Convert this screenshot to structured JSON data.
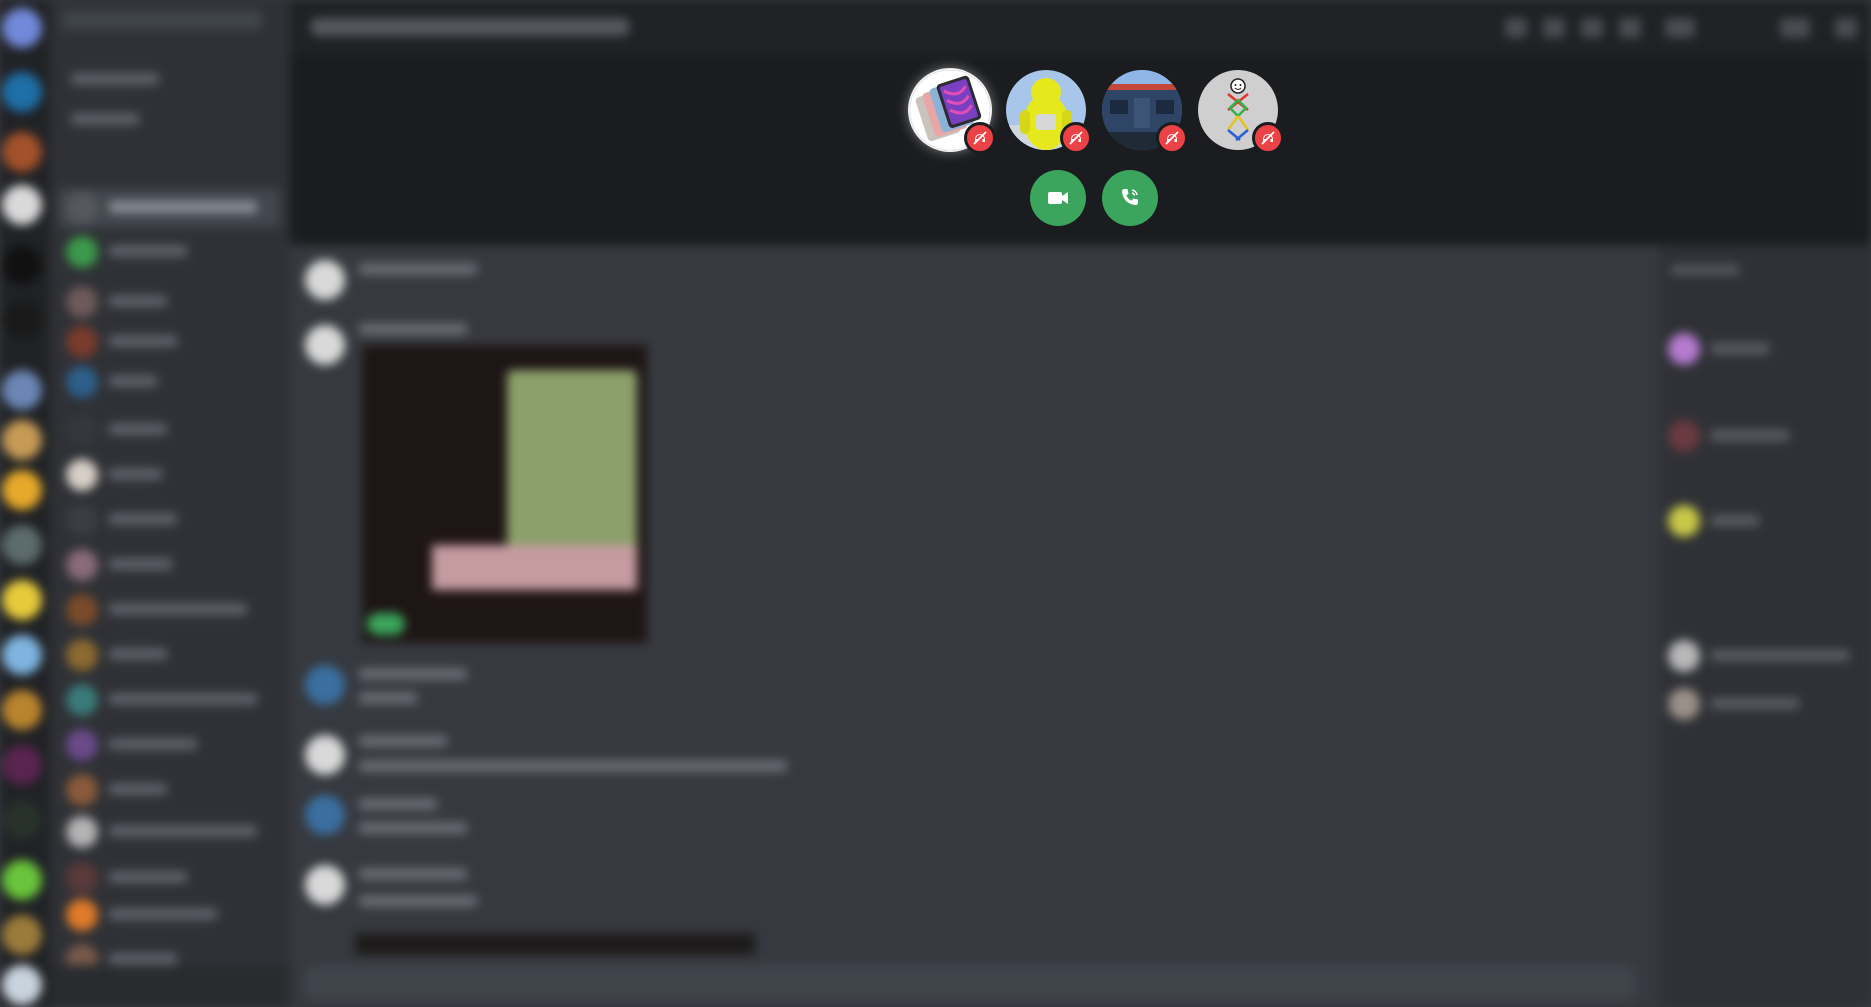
{
  "call": {
    "participants": [
      {
        "avatar": "ipad-colors-avatar",
        "state_icon": "deafened-icon"
      },
      {
        "avatar": "yellow-teletubby-avatar",
        "state_icon": "deafened-icon"
      },
      {
        "avatar": "building-street-avatar",
        "state_icon": "deafened-icon"
      },
      {
        "avatar": "stick-figure-avatar",
        "state_icon": "deafened-icon"
      }
    ],
    "buttons": [
      {
        "name": "video-call-button",
        "icon": "video-camera-icon"
      },
      {
        "name": "voice-call-button",
        "icon": "phone-icon"
      }
    ]
  },
  "colors": {
    "join_green": "#3ba55d",
    "mute_red": "#ed4245",
    "call_bg": "#1a1c1f",
    "chat_bg": "#36393f",
    "sidebar_bg": "#2f3136",
    "guild_rail_bg": "#202225",
    "accent_blurple": "#5865f2"
  }
}
